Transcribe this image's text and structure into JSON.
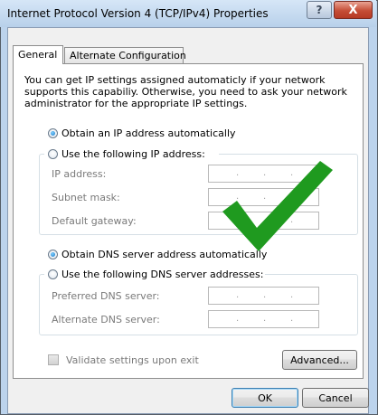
{
  "window": {
    "title": "Internet Protocol Version 4 (TCP/IPv4) Properties",
    "help_glyph": "?",
    "close_glyph": "X"
  },
  "tabs": [
    {
      "label": "General",
      "selected": true
    },
    {
      "label": "Alternate Configuration",
      "selected": false
    }
  ],
  "description": "You can get IP settings assigned automaticly if your network supports this capabiliy. Otherwise, you need to ask your network administrator for the appropriate IP settings.",
  "ip": {
    "auto_label": "Obtain an IP address automatically",
    "auto_selected": true,
    "manual_label": "Use the following IP address:",
    "manual_selected": false,
    "fields": [
      {
        "label": "IP address:",
        "value": ". . ."
      },
      {
        "label": "Subnet mask:",
        "value": ". . ."
      },
      {
        "label": "Default gateway:",
        "value": ". . ."
      }
    ]
  },
  "dns": {
    "auto_label": "Obtain DNS server address automatically",
    "auto_selected": true,
    "manual_label": "Use the following DNS server addresses:",
    "manual_selected": false,
    "fields": [
      {
        "label": "Preferred DNS server:",
        "value": ". . ."
      },
      {
        "label": "Alternate DNS server:",
        "value": ". . ."
      }
    ]
  },
  "validate": {
    "label": "Validate settings upon exit",
    "checked": false,
    "enabled": false
  },
  "buttons": {
    "advanced": "Advanced...",
    "ok": "OK",
    "cancel": "Cancel"
  },
  "overlay": {
    "icon": "green-checkmark-icon",
    "color": "#1f9a1f"
  },
  "colors": {
    "close_button": "#c54d36",
    "radio_selected": "#1978c8",
    "disabled_text": "#7a7a7a"
  }
}
